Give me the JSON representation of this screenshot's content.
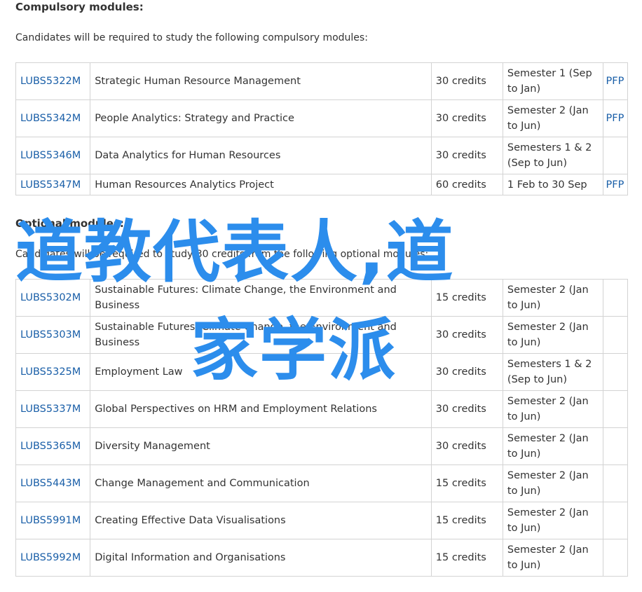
{
  "compulsory": {
    "heading": "Compulsory modules:",
    "intro": "Candidates will be required to study the following compulsory modules:",
    "rows": [
      {
        "code": "LUBS5322M",
        "title": "Strategic Human Resource Management",
        "credits": "30 credits",
        "semester": "Semester 1 (Sep to Jan)",
        "pfp": "PFP"
      },
      {
        "code": "LUBS5342M",
        "title": "People Analytics: Strategy and Practice",
        "credits": "30 credits",
        "semester": "Semester 2 (Jan to Jun)",
        "pfp": "PFP"
      },
      {
        "code": "LUBS5346M",
        "title": "Data Analytics for Human Resources",
        "credits": "30 credits",
        "semester": "Semesters 1 & 2 (Sep to Jun)",
        "pfp": ""
      },
      {
        "code": "LUBS5347M",
        "title": "Human Resources Analytics Project",
        "credits": "60 credits",
        "semester": "1 Feb to 30 Sep",
        "pfp": "PFP"
      }
    ]
  },
  "optional": {
    "heading": "Optional modules:",
    "intro": "Candidates will be required to study 30 credits from the following optional modules:",
    "rows": [
      {
        "code": "LUBS5302M",
        "title": "Sustainable Futures: Climate Change, the Environment and Business",
        "credits": "15 credits",
        "semester": "Semester 2 (Jan to Jun)",
        "pfp": ""
      },
      {
        "code": "LUBS5303M",
        "title": "Sustainable Futures: Climate Change, the Environment and Business",
        "credits": "30 credits",
        "semester": "Semester 2 (Jan to Jun)",
        "pfp": ""
      },
      {
        "code": "LUBS5325M",
        "title": "Employment Law",
        "credits": "30 credits",
        "semester": "Semesters 1 & 2 (Sep to Jun)",
        "pfp": ""
      },
      {
        "code": "LUBS5337M",
        "title": "Global Perspectives on HRM and Employment Relations",
        "credits": "30 credits",
        "semester": "Semester 2 (Jan to Jun)",
        "pfp": ""
      },
      {
        "code": "LUBS5365M",
        "title": "Diversity Management",
        "credits": "30 credits",
        "semester": "Semester 2 (Jan to Jun)",
        "pfp": ""
      },
      {
        "code": "LUBS5443M",
        "title": "Change Management and Communication",
        "credits": "15 credits",
        "semester": "Semester 2 (Jan to Jun)",
        "pfp": ""
      },
      {
        "code": "LUBS5991M",
        "title": "Creating Effective Data Visualisations",
        "credits": "15 credits",
        "semester": "Semester 2 (Jan to Jun)",
        "pfp": ""
      },
      {
        "code": "LUBS5992M",
        "title": "Digital Information and Organisations",
        "credits": "15 credits",
        "semester": "Semester 2 (Jan to Jun)",
        "pfp": ""
      }
    ]
  },
  "overlay": {
    "line1": "道教代表人,道",
    "line2": "家学派",
    "color": "#2c8dec"
  }
}
